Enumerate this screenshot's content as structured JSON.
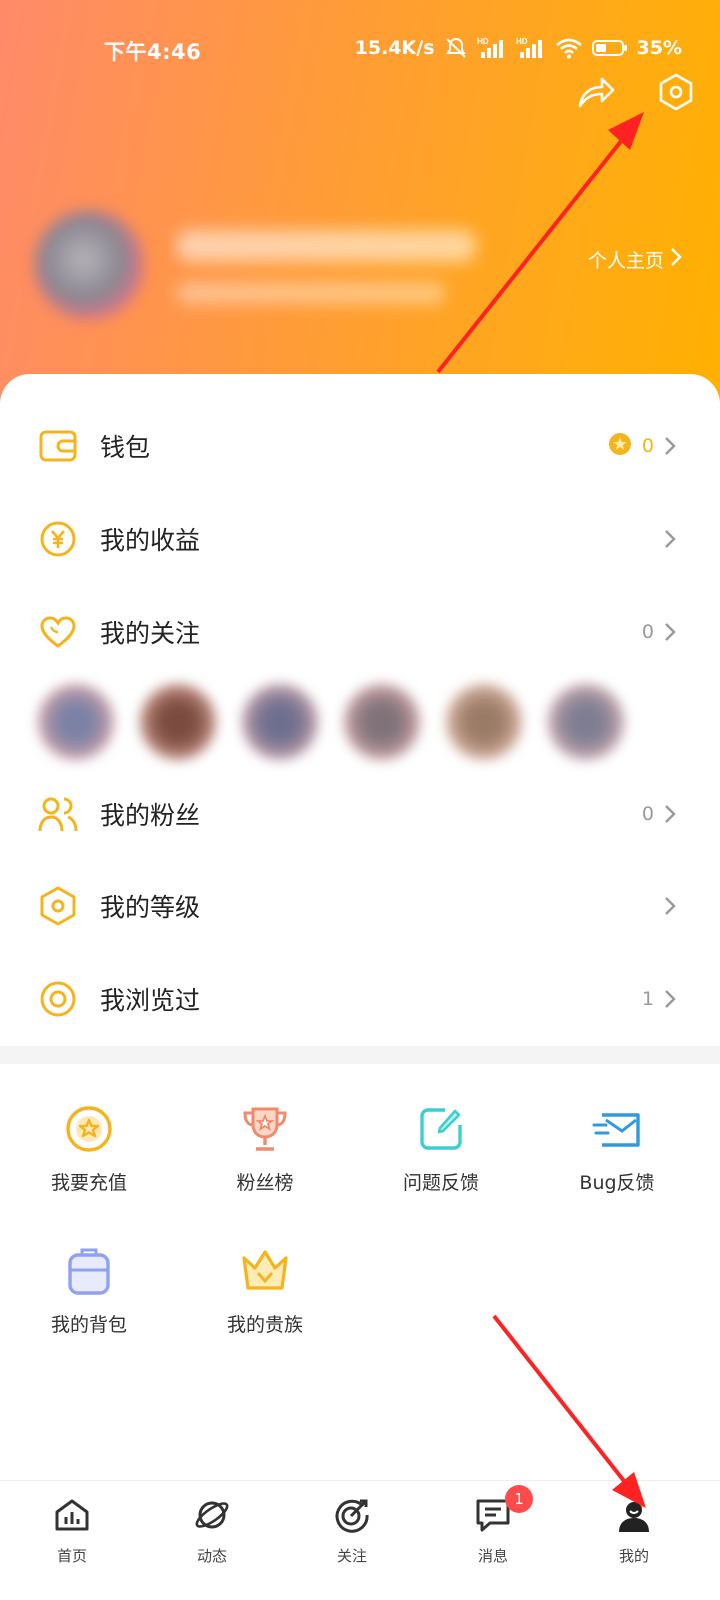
{
  "status_bar": {
    "time": "下午4:46",
    "net_speed": "15.4K/s",
    "battery": "35%"
  },
  "header": {
    "share_icon": "share-icon",
    "settings_icon": "hexagon-settings-icon",
    "homepage_label": "个人主页"
  },
  "menu": {
    "wallet": {
      "label": "钱包",
      "value": "0",
      "icon": "wallet-icon"
    },
    "earnings": {
      "label": "我的收益",
      "icon": "yen-coin-icon"
    },
    "following": {
      "label": "我的关注",
      "value": "0",
      "icon": "heart-icon"
    },
    "fans": {
      "label": "我的粉丝",
      "value": "0",
      "icon": "users-icon"
    },
    "level": {
      "label": "我的等级",
      "icon": "hexagon-level-icon"
    },
    "history": {
      "label": "我浏览过",
      "value": "1",
      "icon": "eye-circle-icon"
    }
  },
  "grid": {
    "recharge": "我要充值",
    "fan_rank": "粉丝榜",
    "feedback": "问题反馈",
    "bug": "Bug反馈",
    "backpack": "我的背包",
    "noble": "我的贵族"
  },
  "nav": {
    "home": "首页",
    "feed": "动态",
    "follow": "关注",
    "messages": "消息",
    "messages_badge": "1",
    "me": "我的"
  },
  "colors": {
    "accent": "#f5b31c",
    "header_start": "#ff8a6a",
    "header_end": "#ffb000",
    "badge": "#ff4b4b",
    "annotation_arrow": "#ff2222"
  }
}
